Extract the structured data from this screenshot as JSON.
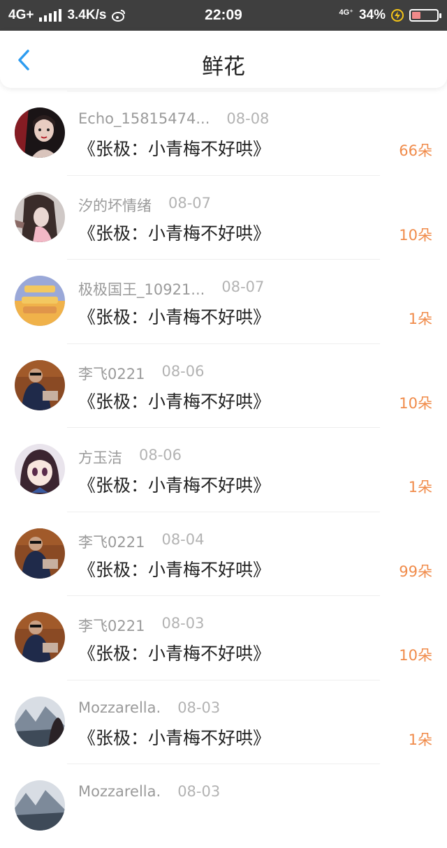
{
  "status_bar": {
    "network": "4G+",
    "speed": "3.4K/s",
    "time": "22:09",
    "network_right": "4G⁺",
    "battery": "34%",
    "battery_level": 0.34,
    "icons": [
      "signal-icon",
      "weibo-icon",
      "charging-icon",
      "battery-icon"
    ]
  },
  "header": {
    "title": "鲜花",
    "back_icon": "chevron-left-icon",
    "accent": "#2d9cf0"
  },
  "colors": {
    "count": "#f08b4a",
    "username": "#9a9a9a",
    "date": "#b3b3b3"
  },
  "items": [
    {
      "user": "Echo_15815474...",
      "date": "08-08",
      "book": "《张极：小青梅不好哄》",
      "count": "66朵"
    },
    {
      "user": "汐的坏情绪",
      "date": "08-07",
      "book": "《张极：小青梅不好哄》",
      "count": "10朵"
    },
    {
      "user": "极极国王_10921...",
      "date": "08-07",
      "book": "《张极：小青梅不好哄》",
      "count": "1朵"
    },
    {
      "user": "李飞0221",
      "date": "08-06",
      "book": "《张极：小青梅不好哄》",
      "count": "10朵"
    },
    {
      "user": "方玉洁",
      "date": "08-06",
      "book": "《张极：小青梅不好哄》",
      "count": "1朵"
    },
    {
      "user": "李飞0221",
      "date": "08-04",
      "book": "《张极：小青梅不好哄》",
      "count": "99朵"
    },
    {
      "user": "李飞0221",
      "date": "08-03",
      "book": "《张极：小青梅不好哄》",
      "count": "10朵"
    },
    {
      "user": "Mozzarella.",
      "date": "08-03",
      "book": "《张极：小青梅不好哄》",
      "count": "1朵"
    },
    {
      "user": "Mozzarella.",
      "date": "08-03",
      "book": "",
      "count": ""
    }
  ]
}
